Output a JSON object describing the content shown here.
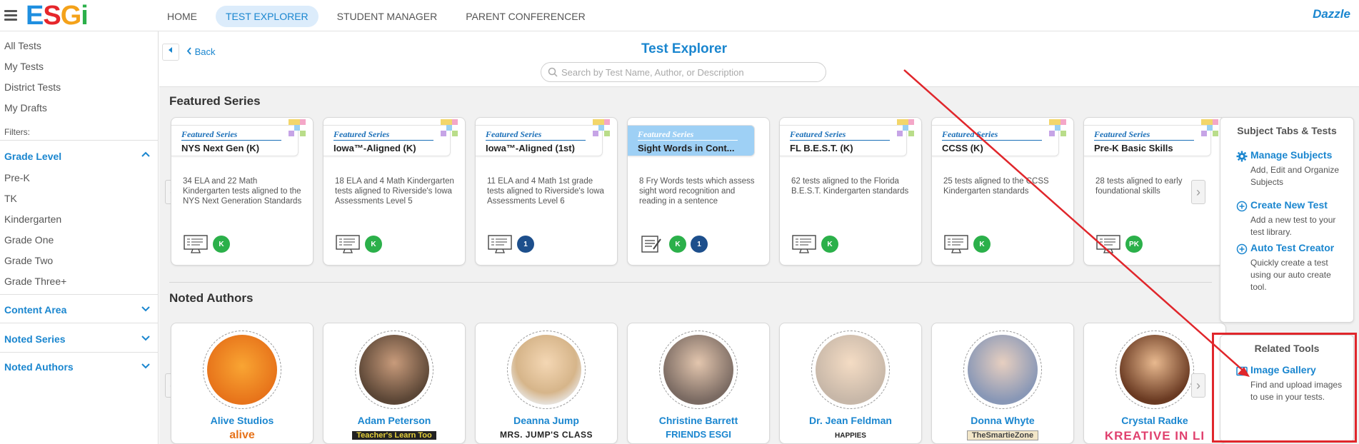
{
  "topbar": {
    "logo": {
      "e": "E",
      "s": "S",
      "g": "G",
      "i": "i"
    },
    "nav": [
      {
        "label": "HOME",
        "active": false
      },
      {
        "label": "TEST EXPLORER",
        "active": true
      },
      {
        "label": "STUDENT MANAGER",
        "active": false
      },
      {
        "label": "PARENT CONFERENCER",
        "active": false
      }
    ],
    "brand_right": "Dazzle"
  },
  "sidebar": {
    "links": [
      "All Tests",
      "My Tests",
      "District Tests",
      "My Drafts"
    ],
    "filters_label": "Filters:",
    "grade_level": {
      "label": "Grade Level",
      "options": [
        "Pre-K",
        "TK",
        "Kindergarten",
        "Grade One",
        "Grade Two",
        "Grade Three+"
      ]
    },
    "content_area": "Content Area",
    "noted_series": "Noted Series",
    "noted_authors": "Noted Authors"
  },
  "header": {
    "back": "Back",
    "title": "Test Explorer",
    "search_placeholder": "Search by Test Name, Author, or Description"
  },
  "featured": {
    "section_title": "Featured Series",
    "tag": "Featured Series",
    "cards": [
      {
        "name": "NYS Next Gen (K)",
        "desc": "34 ELA and 22 Math Kindergarten tests aligned to the NYS Next Generation Standards",
        "badges": [
          "K"
        ],
        "icon": "screen-icon"
      },
      {
        "name": "Iowa™-Aligned (K)",
        "desc": "18 ELA and 4 Math Kindergarten tests aligned to Riverside's Iowa Assessments Level 5",
        "badges": [
          "K"
        ],
        "icon": "screen-icon"
      },
      {
        "name": "Iowa™-Aligned (1st)",
        "desc": "11 ELA and 4 Math 1st grade tests aligned to Riverside's Iowa Assessments Level 6",
        "badges": [
          "1"
        ],
        "icon": "screen-icon"
      },
      {
        "name": "Sight Words in Cont...",
        "desc": "8 Fry Words tests which assess sight word recognition and reading in a sentence",
        "badges": [
          "K",
          "1"
        ],
        "icon": "worksheet-icon"
      },
      {
        "name": "FL B.E.S.T. (K)",
        "desc": "62 tests aligned to the Florida B.E.S.T. Kindergarten standards",
        "badges": [
          "K"
        ],
        "icon": "screen-icon"
      },
      {
        "name": "CCSS (K)",
        "desc": "25 tests aligned to the CCSS Kindergarten standards",
        "badges": [
          "K"
        ],
        "icon": "screen-icon"
      },
      {
        "name": "Pre-K Basic Skills",
        "desc": "28 tests aligned to early foundational skills",
        "badges": [
          "PK"
        ],
        "icon": "screen-icon"
      }
    ]
  },
  "authors": {
    "section_title": "Noted Authors",
    "cards": [
      {
        "name": "Alive Studios",
        "logo": "alive"
      },
      {
        "name": "Adam Peterson",
        "logo": "Teacher's Learn Too"
      },
      {
        "name": "Deanna Jump",
        "logo": "MRS. JUMP'S CLASS"
      },
      {
        "name": "Christine Barrett",
        "logo": "FRIENDS ESGI"
      },
      {
        "name": "Dr. Jean Feldman",
        "logo": "HAPPIES"
      },
      {
        "name": "Donna Whyte",
        "logo": "TheSmartieZone"
      },
      {
        "name": "Crystal Radke",
        "logo": "KREATIVE IN LI"
      }
    ]
  },
  "subject_panel": {
    "title": "Subject Tabs & Tests",
    "items": [
      {
        "link": "Manage Subjects",
        "desc": "Add, Edit and Organize Subjects"
      },
      {
        "link": "Create New Test",
        "desc": "Add a new test to your test library."
      },
      {
        "link": "Auto Test Creator",
        "desc": "Quickly create a test using our auto create tool."
      }
    ]
  },
  "related_panel": {
    "title": "Related Tools",
    "items": [
      {
        "link": "Image Gallery",
        "desc": "Find and upload images to use in your tests."
      }
    ]
  },
  "colors": {
    "accent": "#1a86cf",
    "annotation": "#e0262b",
    "green_badge": "#2bb04a",
    "navy_badge": "#1d4f8c"
  }
}
